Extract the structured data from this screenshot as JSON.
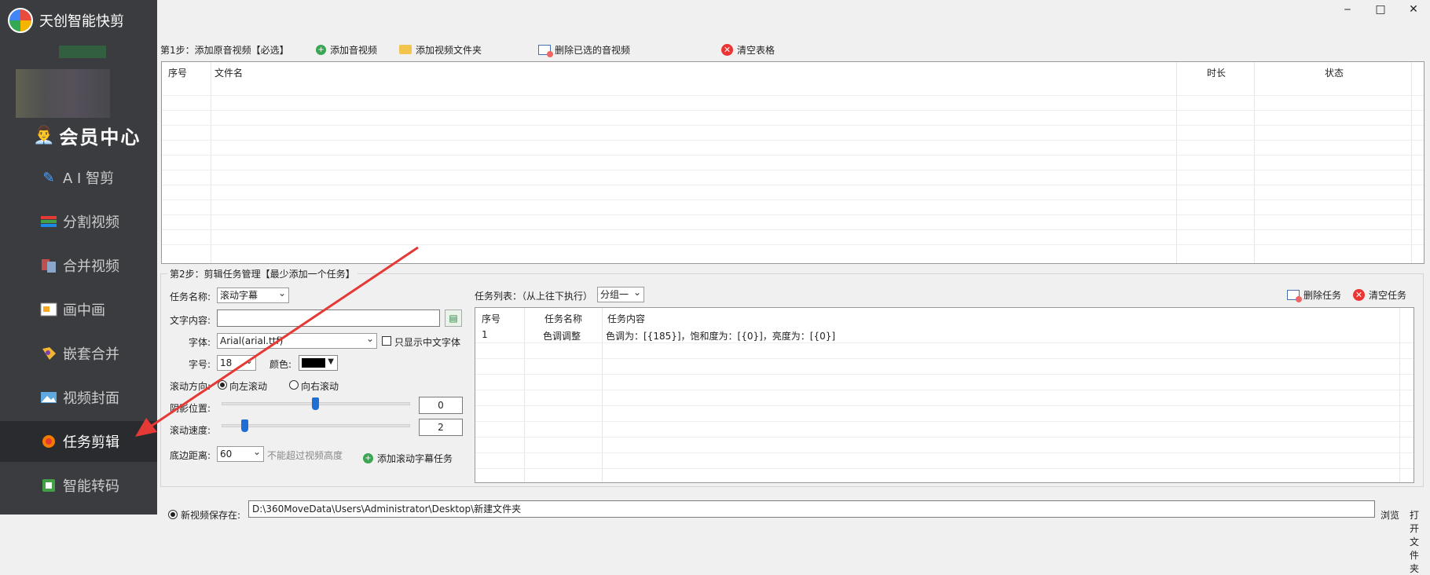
{
  "app": {
    "title": "天创智能快剪"
  },
  "window": {
    "minimize": "‒",
    "maximize": "□",
    "close": "✕"
  },
  "sidebar": {
    "vip": {
      "label": "会员中心",
      "icon": "vip-user-icon"
    },
    "items": [
      {
        "label": "A I 智剪",
        "icon": "ai-edit-icon"
      },
      {
        "label": "分割视频",
        "icon": "split-video-icon"
      },
      {
        "label": "合并视频",
        "icon": "merge-video-icon"
      },
      {
        "label": "画中画",
        "icon": "picture-in-picture-icon"
      },
      {
        "label": "嵌套合并",
        "icon": "nested-merge-icon"
      },
      {
        "label": "视频封面",
        "icon": "video-cover-icon"
      },
      {
        "label": "任务剪辑",
        "icon": "task-edit-icon",
        "active": true
      },
      {
        "label": "智能转码",
        "icon": "transcode-icon"
      }
    ]
  },
  "step1": {
    "label": "第1步：添加原音视频【必选】",
    "buttons": {
      "add_audio_video": "添加音视频",
      "add_folder": "添加视频文件夹",
      "delete_selected": "删除已选的音视频",
      "clear_table": "清空表格"
    },
    "columns": [
      "序号",
      "文件名",
      "时长",
      "状态"
    ]
  },
  "step2": {
    "title": "第2步：剪辑任务管理【最少添加一个任务】",
    "task_name_label": "任务名称:",
    "task_name_value": "滚动字幕",
    "text_content_label": "文字内容:",
    "text_content_value": "",
    "font_label": "字体:",
    "font_value": "Arial(arial.ttf)",
    "chinese_only_label": "只显示中文字体",
    "size_label": "字号:",
    "size_value": "18",
    "color_label": "颜色:",
    "direction_label": "滚动方向:",
    "dir_left": "向左滚动",
    "dir_right": "向右滚动",
    "shadow_label": "阴影位置:",
    "shadow_value": "0",
    "speed_label": "滚动速度:",
    "speed_value": "2",
    "bottom_label": "底边距离:",
    "bottom_value": "60",
    "bottom_hint": "不能超过视频高度",
    "add_button": "添加滚动字幕任务",
    "task_list_label": "任务列表：（从上往下执行）",
    "group_value": "分组一",
    "delete_task": "删除任务",
    "clear_task": "清空任务",
    "task_columns": [
      "序号",
      "任务名称",
      "任务内容"
    ],
    "tasks": [
      {
        "no": "1",
        "name": "色调调整",
        "content": "色调为：[{185}]，饱和度为：[{0}]，亮度为：[{0}]"
      }
    ]
  },
  "bottom": {
    "radio_label": "新视频保存在:",
    "path": "D:\\360MoveData\\Users\\Administrator\\Desktop\\新建文件夹",
    "browse": "浏览",
    "open_folder": "打开文件夹"
  },
  "colors": {
    "sidebar_bg": "#3a3c40",
    "active_bg": "#2a2b2e",
    "font_color_value": "#000000",
    "annotation_arrow": "#e53935"
  }
}
